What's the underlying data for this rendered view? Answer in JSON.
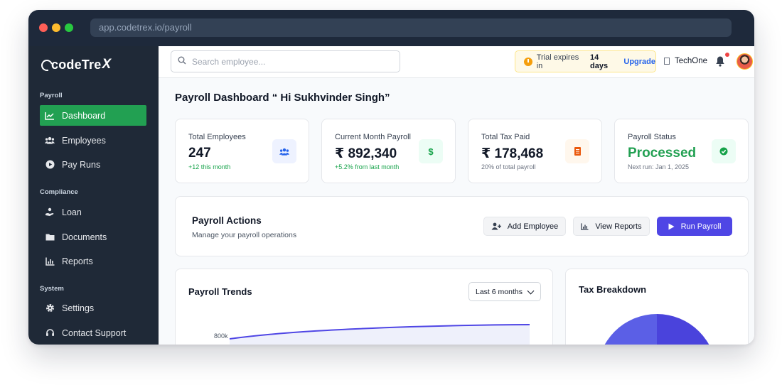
{
  "browser": {
    "url": "app.codetrex.io/payroll"
  },
  "brand": {
    "name": "codeTre",
    "mark": "X"
  },
  "sidebar": {
    "sections": [
      {
        "label": "Payroll"
      },
      {
        "label": "Compliance"
      },
      {
        "label": "System"
      }
    ],
    "items": [
      {
        "label": "Dashboard",
        "icon": "chart-line-icon",
        "active": true
      },
      {
        "label": "Employees",
        "icon": "users-icon"
      },
      {
        "label": "Pay Runs",
        "icon": "play-circle-icon"
      },
      {
        "label": "Loan",
        "icon": "hand-holding-coin-icon"
      },
      {
        "label": "Documents",
        "icon": "folder-icon"
      },
      {
        "label": "Reports",
        "icon": "bar-chart-icon"
      },
      {
        "label": "Settings",
        "icon": "gear-icon"
      },
      {
        "label": "Contact Support",
        "icon": "headset-icon"
      }
    ]
  },
  "topbar": {
    "search_placeholder": "Search employee...",
    "trial_prefix": "Trial expires in",
    "trial_days": "14 days",
    "upgrade_label": "Upgrade",
    "company": "TechOne",
    "has_notification": true
  },
  "page": {
    "title": "Payroll Dashboard “ Hi Sukhvinder Singh”"
  },
  "stats": [
    {
      "label": "Total Employees",
      "value": "247",
      "sub": "+12 this month",
      "icon": "users-icon",
      "accent": "#2563eb",
      "badge_bg": "#eef2ff"
    },
    {
      "label": "Current Month Payroll",
      "value": "₹ 892,340",
      "sub": "+5.2% from last month",
      "icon": "dollar-icon",
      "accent": "#16a34a",
      "badge_bg": "#ecfdf5"
    },
    {
      "label": "Total Tax Paid",
      "value": "₹ 178,468",
      "sub": "20% of total payroll",
      "icon": "receipt-icon",
      "accent": "#ea580c",
      "badge_bg": "#fff7ed"
    },
    {
      "label": "Payroll Status",
      "value": "Processed",
      "sub": "Next run: Jan 1, 2025",
      "icon": "check-circle-icon",
      "accent": "#16a34a",
      "badge_bg": "#ecfdf5"
    }
  ],
  "actions": {
    "title": "Payroll Actions",
    "subtitle": "Manage your payroll operations",
    "buttons": [
      {
        "label": "Add Employee",
        "icon": "user-plus-icon"
      },
      {
        "label": "View Reports",
        "icon": "bar-chart-icon"
      },
      {
        "label": "Run Payroll",
        "icon": "play-icon"
      }
    ]
  },
  "trends": {
    "title": "Payroll Trends",
    "range_selected": "Last 6 months",
    "y_tick_label": "800k"
  },
  "tax": {
    "title": "Tax Breakdown"
  },
  "colors": {
    "sidebar_bg": "#1f2937",
    "active_nav": "#22a052",
    "primary": "#4f46e5",
    "trend_line": "#4f46e5"
  }
}
